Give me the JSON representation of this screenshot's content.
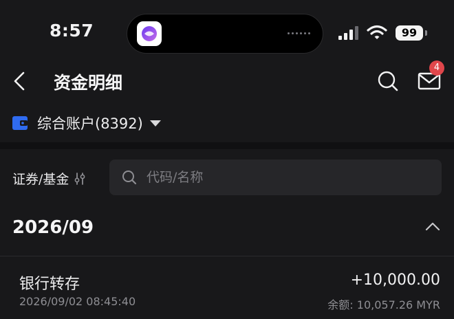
{
  "status_bar": {
    "time": "8:57",
    "battery": "99"
  },
  "nav": {
    "title": "资金明细",
    "mail_badge": "4"
  },
  "account": {
    "label": "综合账户(8392)"
  },
  "filter": {
    "label": "证券/基金",
    "search_placeholder": "代码/名称"
  },
  "month_group": {
    "month": "2026/09"
  },
  "transactions": [
    {
      "title": "银行转存",
      "time": "2026/09/02 08:45:40",
      "amount": "+10,000.00",
      "balance": "余额: 10,057.26 MYR"
    }
  ],
  "colors": {
    "background": "#18181a",
    "accent_blue": "#2f6bf0",
    "badge_red": "#e0464b"
  },
  "icons": [
    "back-arrow-icon",
    "search-icon",
    "mail-icon",
    "wallet-icon",
    "caret-down-icon",
    "tune-icon",
    "chevron-up-icon",
    "signal-icon",
    "wifi-icon",
    "battery-icon"
  ]
}
